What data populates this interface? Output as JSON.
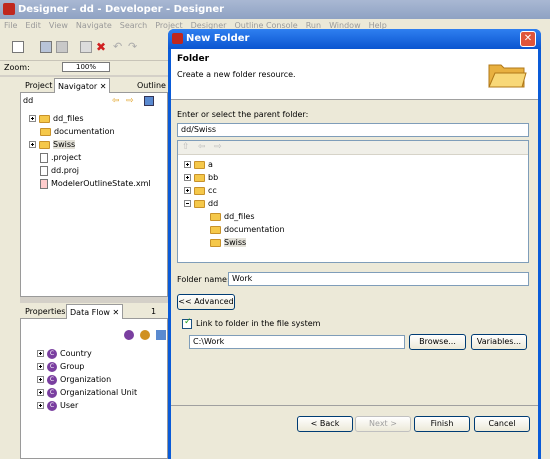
{
  "window": {
    "title": "Designer - dd - Developer - Designer"
  },
  "menubar": [
    "File",
    "Edit",
    "View",
    "Navigate",
    "Search",
    "Project",
    "Designer",
    "Outline Console",
    "Run",
    "Window",
    "Help"
  ],
  "zoom": {
    "label": "Zoom:",
    "value": "100%"
  },
  "left_panel": {
    "tabs": [
      "Project",
      "Navigator",
      "Outline"
    ],
    "path": "dd",
    "items": [
      {
        "label": "dd_files",
        "type": "folder",
        "expandable": true
      },
      {
        "label": "documentation",
        "type": "folder",
        "expandable": false
      },
      {
        "label": "Swiss",
        "type": "folder",
        "expandable": true
      },
      {
        "label": ".project",
        "type": "file",
        "expandable": false
      },
      {
        "label": "dd.proj",
        "type": "file",
        "expandable": false
      },
      {
        "label": "ModelerOutlineState.xml",
        "type": "xml",
        "expandable": false
      }
    ]
  },
  "bottom_panel": {
    "tabs": [
      "Properties",
      "Data Flow",
      "1"
    ],
    "items": [
      "Country",
      "Group",
      "Organization",
      "Organizational Unit",
      "User"
    ]
  },
  "dialog": {
    "title": "New Folder",
    "header_title": "Folder",
    "header_desc": "Create a new folder resource.",
    "parent_label": "Enter or select the parent folder:",
    "parent_value": "dd/Swiss",
    "tree": [
      {
        "label": "a",
        "level": 0,
        "expanded": false
      },
      {
        "label": "bb",
        "level": 0,
        "expanded": false
      },
      {
        "label": "cc",
        "level": 0,
        "expanded": false
      },
      {
        "label": "dd",
        "level": 0,
        "expanded": true
      },
      {
        "label": "dd_files",
        "level": 1,
        "expanded": false
      },
      {
        "label": "documentation",
        "level": 1,
        "expanded": false
      },
      {
        "label": "Swiss",
        "level": 1,
        "expanded": false,
        "selected": true
      }
    ],
    "folder_name_label": "Folder name:",
    "folder_name_value": "Work",
    "advanced_button": "<< Advanced",
    "link_checkbox_label": "Link to folder in the file system",
    "link_path": "C:\\Work",
    "browse_button": "Browse...",
    "variables_button": "Variables...",
    "back_button": "< Back",
    "next_button": "Next >",
    "finish_button": "Finish",
    "cancel_button": "Cancel"
  }
}
